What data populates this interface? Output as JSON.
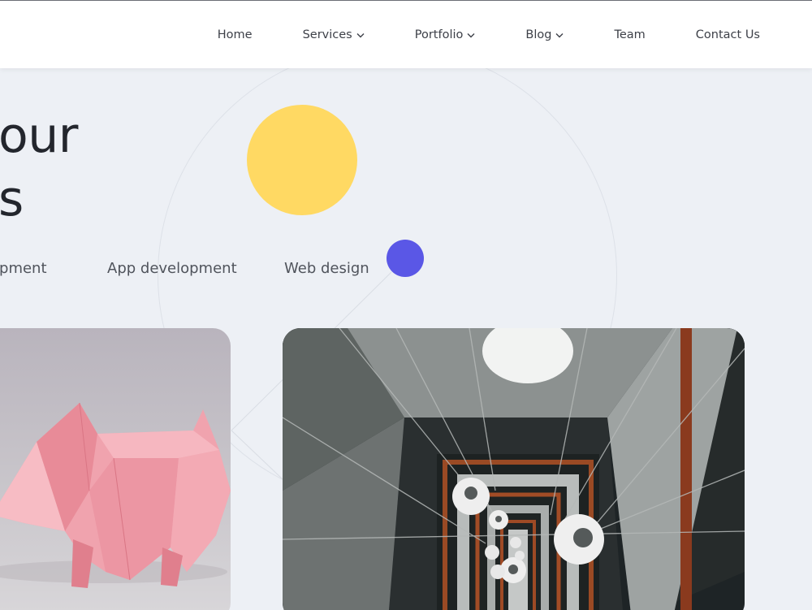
{
  "nav": {
    "items": [
      {
        "label": "Home",
        "dropdown": false
      },
      {
        "label": "Services",
        "dropdown": true
      },
      {
        "label": "Portfolio",
        "dropdown": true
      },
      {
        "label": "Blog",
        "dropdown": true
      },
      {
        "label": "Team",
        "dropdown": false
      },
      {
        "label": "Contact Us",
        "dropdown": false
      }
    ]
  },
  "hero": {
    "title_line1": "our",
    "title_line2": "s"
  },
  "services": {
    "items": [
      "opment",
      "App development",
      "Web design"
    ]
  },
  "colors": {
    "background": "#edf0f5",
    "accent_yellow": "#ffd963",
    "accent_purple": "#5a57e6",
    "nav_bg": "#ffffff"
  },
  "icons": {
    "dropdown": "chevron-down-icon"
  },
  "images": {
    "left": "origami-pig-photo",
    "right": "stairwell-photo"
  }
}
